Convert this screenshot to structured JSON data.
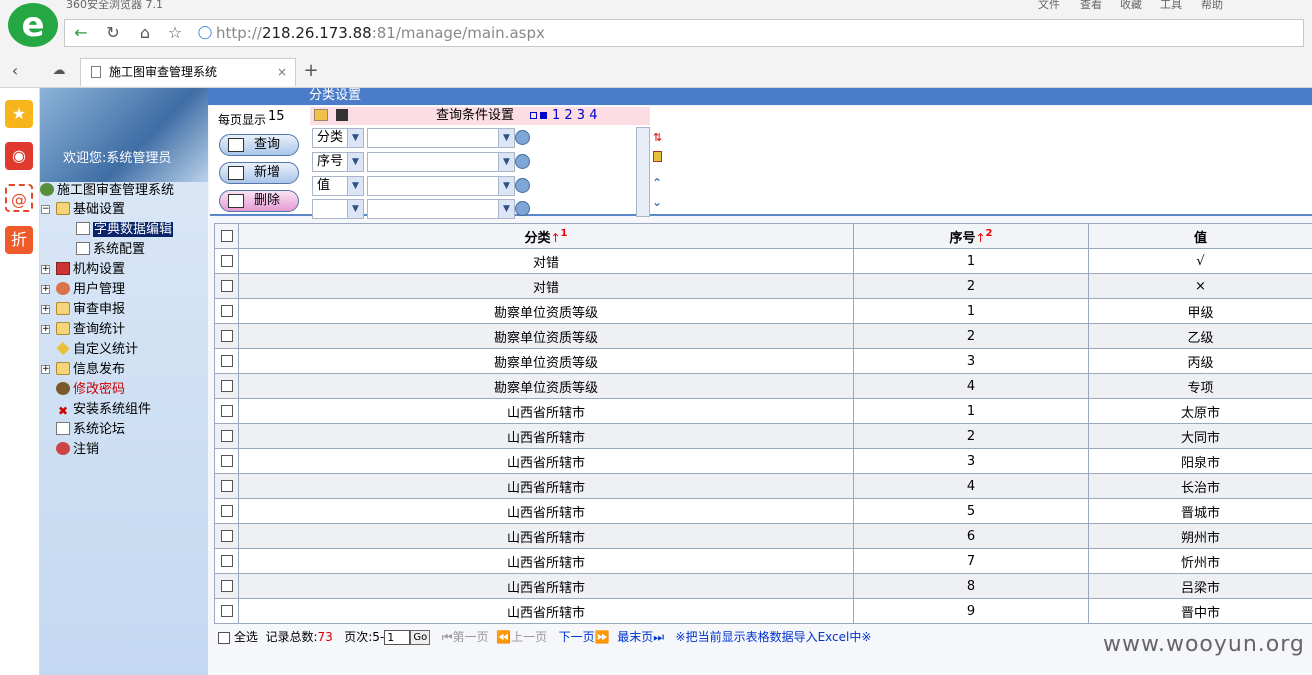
{
  "browser": {
    "app_title": "360安全浏览器 7.1",
    "menu": [
      "文件",
      "查看",
      "收藏",
      "工具",
      "帮助"
    ],
    "url_prefix": "http://",
    "url_host": "218.26.173.88",
    "url_rest": ":81/manage/main.aspx",
    "tab_title": "施工图审查管理系统",
    "new_tab": "+",
    "logo_glyph": "e"
  },
  "tree": {
    "welcome": "欢迎您:系统管理员",
    "nodes": [
      {
        "label": "施工图审查管理系统",
        "icon": "globe-icon"
      },
      {
        "label": "基础设置",
        "icon": "folder-open-icon"
      },
      {
        "label": "字典数据编辑",
        "icon": "document-icon",
        "selected": true
      },
      {
        "label": "系统配置",
        "icon": "document-icon"
      },
      {
        "label": "机构设置",
        "icon": "building-icon"
      },
      {
        "label": "用户管理",
        "icon": "users-icon"
      },
      {
        "label": "审查申报",
        "icon": "folder-icon"
      },
      {
        "label": "查询统计",
        "icon": "folder-icon"
      },
      {
        "label": "自定义统计",
        "icon": "diamond-icon"
      },
      {
        "label": "信息发布",
        "icon": "folder-icon"
      },
      {
        "label": "修改密码",
        "icon": "key-user-icon",
        "color": "#cc0000"
      },
      {
        "label": "安装系统组件",
        "icon": "install-icon"
      },
      {
        "label": "系统论坛",
        "icon": "document-icon"
      },
      {
        "label": "注销",
        "icon": "logout-icon"
      }
    ]
  },
  "main": {
    "title": "分类设置",
    "per_page_label": "每页显示",
    "per_page_value": "15",
    "buttons": {
      "query": "查询",
      "add": "新增",
      "delete": "删除"
    },
    "query_header": "查询条件设置",
    "query_pages": "1 2 3 4",
    "query_rows": [
      {
        "field": "分类",
        "value": ""
      },
      {
        "field": "序号",
        "value": ""
      },
      {
        "field": "值",
        "value": ""
      },
      {
        "field": "",
        "value": ""
      }
    ]
  },
  "table": {
    "columns": [
      "分类",
      "序号",
      "值"
    ],
    "sort_marks": [
      "↑",
      "↑"
    ],
    "sort_orders": [
      "1",
      "2"
    ],
    "rows": [
      [
        "对错",
        "1",
        "√"
      ],
      [
        "对错",
        "2",
        "×"
      ],
      [
        "勘察单位资质等级",
        "1",
        "甲级"
      ],
      [
        "勘察单位资质等级",
        "2",
        "乙级"
      ],
      [
        "勘察单位资质等级",
        "3",
        "丙级"
      ],
      [
        "勘察单位资质等级",
        "4",
        "专项"
      ],
      [
        "山西省所辖市",
        "1",
        "太原市"
      ],
      [
        "山西省所辖市",
        "2",
        "大同市"
      ],
      [
        "山西省所辖市",
        "3",
        "阳泉市"
      ],
      [
        "山西省所辖市",
        "4",
        "长治市"
      ],
      [
        "山西省所辖市",
        "5",
        "晋城市"
      ],
      [
        "山西省所辖市",
        "6",
        "朔州市"
      ],
      [
        "山西省所辖市",
        "7",
        "忻州市"
      ],
      [
        "山西省所辖市",
        "8",
        "吕梁市"
      ],
      [
        "山西省所辖市",
        "9",
        "晋中市"
      ]
    ]
  },
  "footer": {
    "select_all": "全选",
    "total_label": "记录总数:",
    "total_value": "73",
    "page_label": "页次:5-",
    "page_input": "1",
    "go": "Go",
    "first": "第一页",
    "prev": "上一页",
    "next": "下一页",
    "last": "最末页",
    "export": "※把当前显示表格数据导入Excel中※"
  },
  "watermark": "www.wooyun.org"
}
